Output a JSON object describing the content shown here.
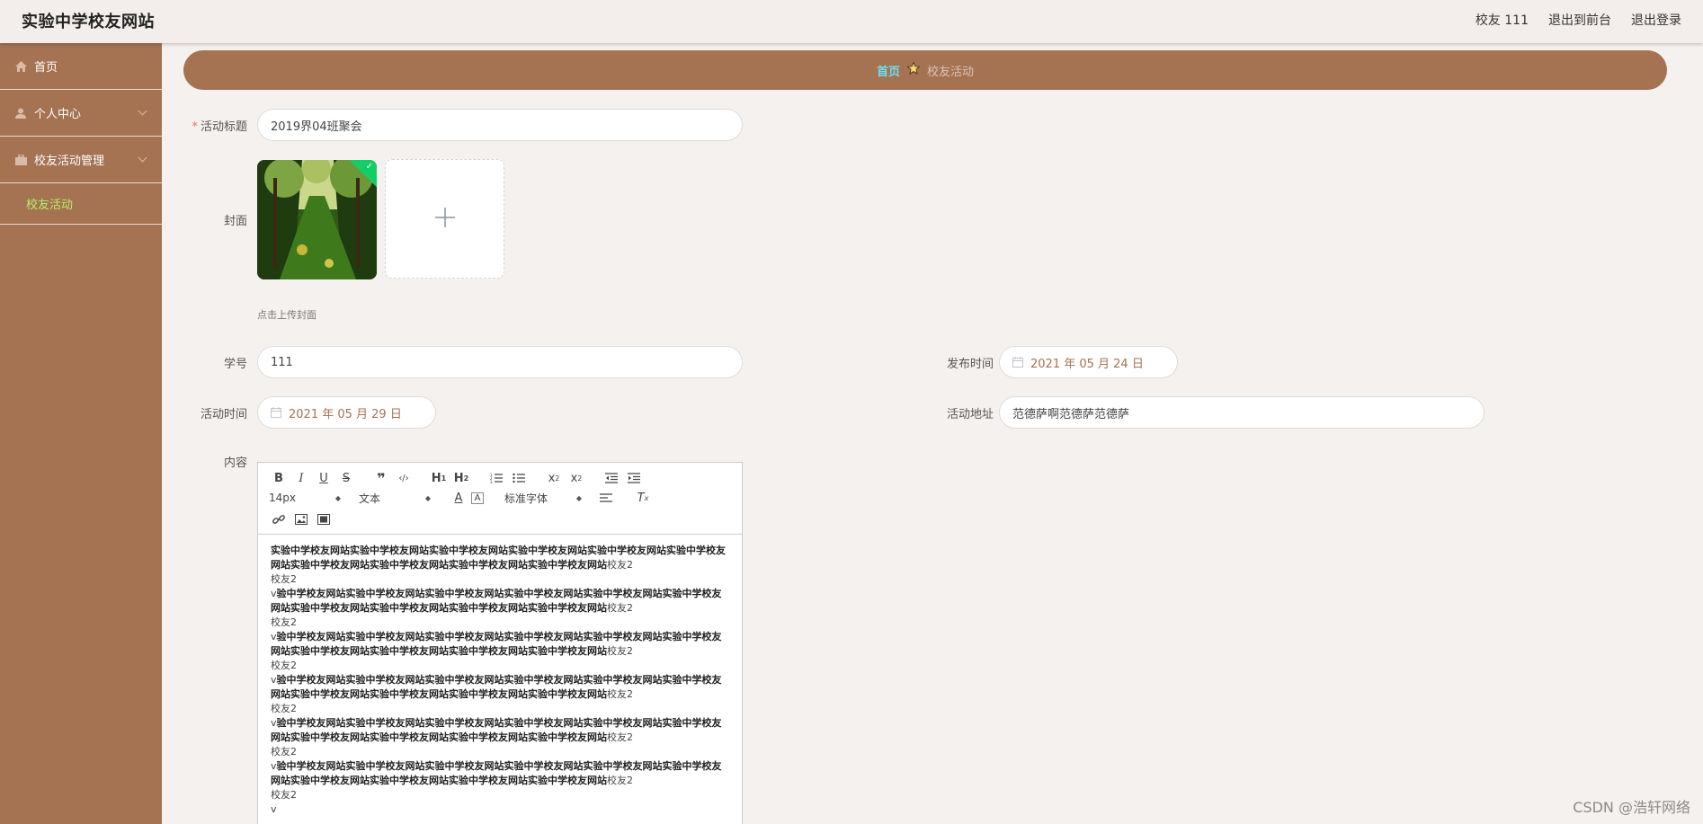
{
  "header": {
    "title": "实验中学校友网站",
    "user": "校友 111",
    "to_front": "退出到前台",
    "logout": "退出登录"
  },
  "sidebar": {
    "items": [
      {
        "label": "首页",
        "icon": "home-icon"
      },
      {
        "label": "个人中心",
        "icon": "user-icon"
      },
      {
        "label": "校友活动管理",
        "icon": "briefcase-icon"
      }
    ],
    "submenu": {
      "label": "校友活动"
    }
  },
  "breadcrumb": {
    "home": "首页",
    "current": "校友活动"
  },
  "form": {
    "title_label": "活动标题",
    "title_value": "2019界04班聚会",
    "cover_label": "封面",
    "cover_hint": "点击上传封面",
    "student_id_label": "学号",
    "student_id_value": "111",
    "publish_time_label": "发布时间",
    "publish_time_value": "2021 年 05 月 24 日",
    "activity_time_label": "活动时间",
    "activity_time_value": "2021 年 05 月 29 日",
    "address_label": "活动地址",
    "address_value": "范德萨啊范德萨范德萨",
    "content_label": "内容"
  },
  "editor": {
    "font_size": "14px",
    "text_type": "文本",
    "font_family": "标准字体",
    "content": {
      "line_bold": "验中学校友网站实验中学校友网站实验中学校友网站实验中学校友网站实验中学校友网站实验中学校友网站实验中学校友网站实验中学校友网站实验中学校友网站实验中学校友网站",
      "line_first_bold": "实验中学校友网站实验中学校友网站实验中学校友网站实验中学校友网站实验中学校友网站实验中学校友网站实验中学校友网站实验中学校友网站实验中学校友网站实验中学校友网站",
      "suffix": "校友2",
      "own_line": "校友2",
      "prefix": "v",
      "last": "v"
    }
  },
  "watermark": "CSDN @浩轩网络",
  "colors": {
    "accent": "#a57252",
    "breadcrumb_home": "#6ee0f0",
    "submenu_active": "#b8f06a"
  }
}
